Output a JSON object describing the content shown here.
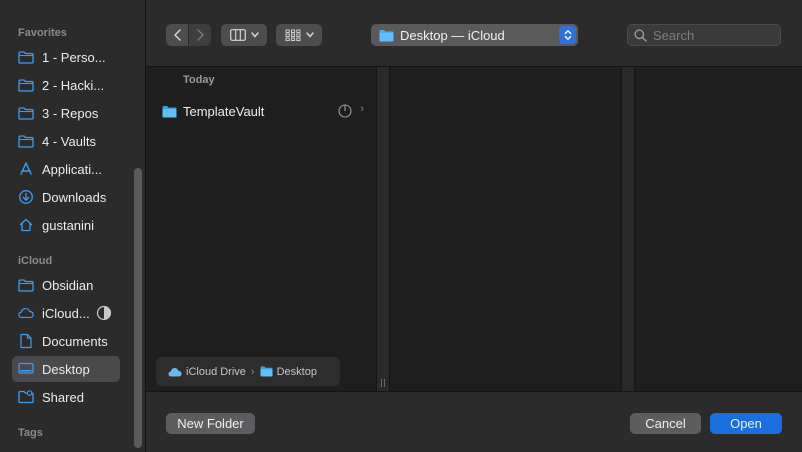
{
  "sidebar": {
    "favorites_header": "Favorites",
    "favorites": [
      {
        "label": "1 - Perso...",
        "icon": "folder-icon"
      },
      {
        "label": "2 - Hacki...",
        "icon": "folder-icon"
      },
      {
        "label": "3 - Repos",
        "icon": "folder-icon"
      },
      {
        "label": "4 - Vaults",
        "icon": "folder-icon"
      },
      {
        "label": "Applicati...",
        "icon": "applications-icon"
      },
      {
        "label": "Downloads",
        "icon": "downloads-icon"
      },
      {
        "label": "gustanini",
        "icon": "home-icon"
      }
    ],
    "icloud_header": "iCloud",
    "icloud": [
      {
        "label": "Obsidian",
        "icon": "folder-icon"
      },
      {
        "label": "iCloud...",
        "icon": "icloud-icon"
      },
      {
        "label": "Documents",
        "icon": "document-icon"
      },
      {
        "label": "Desktop",
        "icon": "desktop-icon",
        "selected": true
      },
      {
        "label": "Shared",
        "icon": "shared-folder-icon"
      }
    ],
    "tags_header": "Tags"
  },
  "toolbar": {
    "location": "Desktop — iCloud",
    "search_placeholder": "Search"
  },
  "browser": {
    "group_header": "Today",
    "items": [
      {
        "name": "TemplateVault",
        "icon": "folder-icon"
      }
    ],
    "path": [
      "iCloud Drive",
      "Desktop"
    ]
  },
  "footer": {
    "new_folder": "New Folder",
    "cancel": "Cancel",
    "open": "Open"
  },
  "colors": {
    "accent": "#1a6fe0",
    "folder_blue": "#4ab0f0",
    "sidebar_icon": "#3d9cf0"
  }
}
